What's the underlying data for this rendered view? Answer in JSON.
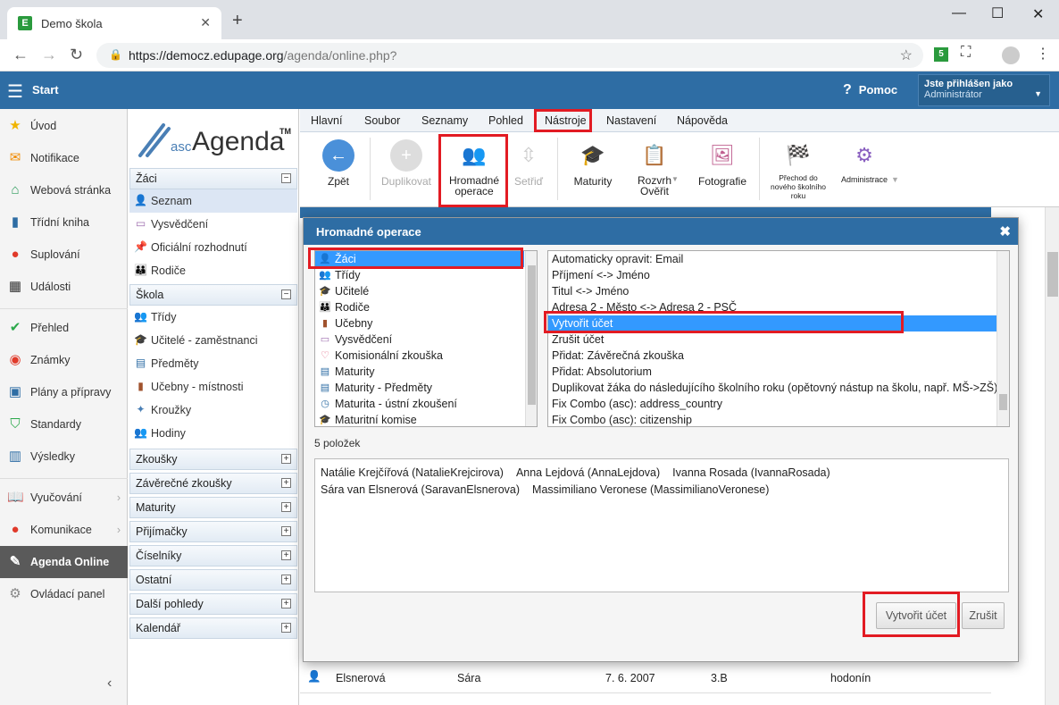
{
  "browser": {
    "tab_title": "Demo škola",
    "tab_favicon": "E",
    "url_host": "https://democz.edupage.org",
    "url_path": "/agenda/online.php?",
    "ext_label": "5"
  },
  "header": {
    "start_label": "Start",
    "help_label": "Pomoc",
    "user_title": "Jste přihlášen jako",
    "user_name": "Administrátor"
  },
  "leftnav": [
    {
      "label": "Úvod",
      "icon": "star-icon",
      "color": "#f0b400"
    },
    {
      "label": "Notifikace",
      "icon": "envelope-icon",
      "color": "#f08a00"
    },
    {
      "label": "Webová stránka",
      "icon": "home-icon",
      "color": "#2a9a5a"
    },
    {
      "label": "Třídní kniha",
      "icon": "book-icon",
      "color": "#2e6da4"
    },
    {
      "label": "Suplování",
      "icon": "person-icon",
      "color": "#e03a2a"
    },
    {
      "label": "Události",
      "icon": "calendar-icon",
      "color": "#333333"
    },
    {
      "label": "Přehled",
      "icon": "check-icon",
      "color": "#2aa84a"
    },
    {
      "label": "Známky",
      "icon": "grade-icon",
      "color": "#e03a2a"
    },
    {
      "label": "Plány a přípravy",
      "icon": "briefcase-icon",
      "color": "#2e6da4"
    },
    {
      "label": "Standardy",
      "icon": "shield-icon",
      "color": "#2aa84a"
    },
    {
      "label": "Výsledky",
      "icon": "bar-chart-icon",
      "color": "#2e6da4"
    },
    {
      "label": "Vyučování",
      "icon": "book-open-icon",
      "color": "#2e6da4"
    },
    {
      "label": "Komunikace",
      "icon": "chat-icon",
      "color": "#e03a2a"
    },
    {
      "label": "Agenda Online",
      "icon": "pen-icon",
      "color": "#ffffff"
    },
    {
      "label": "Ovládací panel",
      "icon": "gear-icon",
      "color": "#888888"
    }
  ],
  "agenda": {
    "logo_small": "asc",
    "logo_big": "Agenda",
    "logo_tm": "TM",
    "sections": {
      "zaci": "Žáci",
      "skola": "Škola",
      "zkousky": "Zkoušky",
      "zaverecne": "Závěrečné zkoušky",
      "maturity": "Maturity",
      "prijimacky": "Přijímačky",
      "ciselniky": "Číselníky",
      "ostatni": "Ostatní",
      "dalsi": "Další pohledy",
      "kalendar": "Kalendář"
    },
    "zaci_items": [
      "Seznam",
      "Vysvědčení",
      "Oficiální rozhodnutí",
      "Rodiče"
    ],
    "skola_items": [
      "Třídy",
      "Učitelé - zaměstnanci",
      "Předměty",
      "Učebny - místnosti",
      "Kroužky",
      "Hodiny"
    ]
  },
  "menutabs": [
    "Hlavní",
    "Soubor",
    "Seznamy",
    "Pohled",
    "Nástroje",
    "Nastavení",
    "Nápověda"
  ],
  "ribbon": {
    "zpet": "Zpět",
    "duplikovat": "Duplikovat",
    "hromadne1": "Hromadné",
    "hromadne2": "operace",
    "setrid": "Setřiď",
    "maturity": "Maturity",
    "rozvrh1": "Rozvrh",
    "rozvrh2": "Ověřit",
    "fotografie": "Fotografie",
    "prechod1": "Přechod do",
    "prechod2": "nového školního",
    "prechod3": "roku",
    "administrace": "Administrace"
  },
  "bgrow": {
    "c1": "Elsnerová",
    "c2": "Sára",
    "c3": "7. 6. 2007",
    "c4": "3.B",
    "c5": "hodonín"
  },
  "dialog": {
    "title": "Hromadné operace",
    "left_list": [
      {
        "label": "Žáci",
        "icon": "student-icon"
      },
      {
        "label": "Třídy",
        "icon": "class-icon"
      },
      {
        "label": "Učitelé",
        "icon": "teacher-icon"
      },
      {
        "label": "Rodiče",
        "icon": "parents-icon"
      },
      {
        "label": "Učebny",
        "icon": "door-icon"
      },
      {
        "label": "Vysvědčení",
        "icon": "certificate-icon"
      },
      {
        "label": "Komisionální zkouška",
        "icon": "heart-icon"
      },
      {
        "label": "Maturity",
        "icon": "book-icon"
      },
      {
        "label": "Maturity - Předměty",
        "icon": "book-icon"
      },
      {
        "label": "Maturita - ústní zkoušení",
        "icon": "clock-icon"
      },
      {
        "label": "Maturitní komise",
        "icon": "graduation-cap-icon"
      }
    ],
    "right_list": [
      "Automaticky opravit: Email",
      "Příjmení <-> Jméno",
      "Titul <-> Jméno",
      "Adresa 2 - Město <-> Adresa 2 - PSČ",
      "Vytvořit účet",
      "Zrušit účet",
      "Přidat: Závěrečná zkouška",
      "Přidat: Absolutorium",
      "Duplikovat žáka do následujícího školního roku (opětovný nástup na školu, např. MŠ->ZŠ)",
      "Fix Combo (asc): address_country",
      "Fix Combo (asc): citizenship"
    ],
    "count": "5 položek",
    "names_line1": [
      "Natálie Krejčířová (NatalieKrejcirova)",
      "Anna Lejdová (AnnaLejdova)",
      "Ivanna Rosada (IvannaRosada)"
    ],
    "names_line2": [
      "Sára van Elsnerová (SaravanElsnerova)",
      "Massimiliano Veronese (MassimilianoVeronese)"
    ],
    "create_btn": "Vytvořit účet",
    "cancel_btn": "Zrušit"
  },
  "colors": {
    "accent": "#2e6da4",
    "highlight": "#e21b23",
    "selection": "#3399ff"
  }
}
